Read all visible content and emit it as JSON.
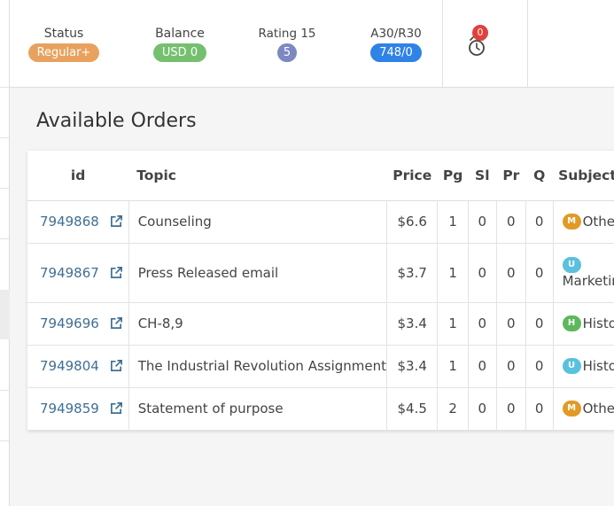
{
  "header": {
    "status": {
      "label": "Status",
      "value": "Regular+",
      "color": "#e8a25e"
    },
    "balance": {
      "label": "Balance",
      "value": "USD 0",
      "color": "#74c06f"
    },
    "rating": {
      "label": "Rating 15",
      "value": "5",
      "color": "#7d88c2"
    },
    "a30r30": {
      "label": "A30/R30",
      "value": "748/0",
      "color": "#2f82e6"
    },
    "alarm": {
      "icon": "alarm-clock-icon",
      "count": "0"
    }
  },
  "main": {
    "title": "Available Orders",
    "columns": [
      "id",
      "Topic",
      "Price",
      "Pg",
      "Sl",
      "Pr",
      "Q",
      "Subject"
    ],
    "rows": [
      {
        "id": "7949868",
        "topic": "Counseling",
        "price": "$6.6",
        "pg": "1",
        "sl": "0",
        "pr": "0",
        "q": "0",
        "level": "M",
        "level_color": "#e29a26",
        "subject": "Other"
      },
      {
        "id": "7949867",
        "topic": "Press Released email",
        "price": "$3.7",
        "pg": "1",
        "sl": "0",
        "pr": "0",
        "q": "0",
        "level": "U",
        "level_color": "#5bc0de",
        "subject": "Marketing"
      },
      {
        "id": "7949696",
        "topic": "CH-8,9",
        "price": "$3.4",
        "pg": "1",
        "sl": "0",
        "pr": "0",
        "q": "0",
        "level": "H",
        "level_color": "#5cb85c",
        "subject": "History"
      },
      {
        "id": "7949804",
        "topic": "The Industrial Revolution Assignment",
        "price": "$3.4",
        "pg": "1",
        "sl": "0",
        "pr": "0",
        "q": "0",
        "level": "U",
        "level_color": "#5bc0de",
        "subject": "History"
      },
      {
        "id": "7949859",
        "topic": "Statement of purpose",
        "price": "$4.5",
        "pg": "2",
        "sl": "0",
        "pr": "0",
        "q": "0",
        "level": "M",
        "level_color": "#e29a26",
        "subject": "Other"
      }
    ]
  }
}
